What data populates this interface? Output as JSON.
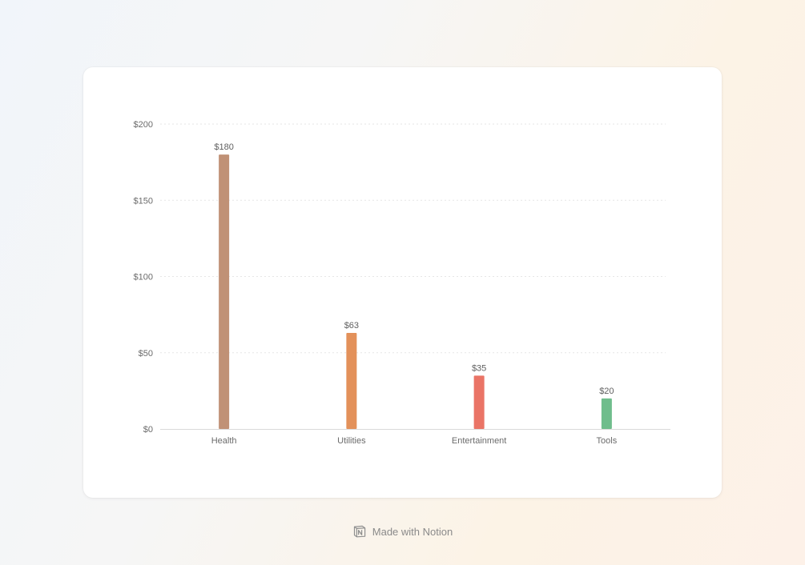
{
  "chart_data": {
    "type": "bar",
    "categories": [
      "Health",
      "Utilities",
      "Entertainment",
      "Tools"
    ],
    "values": [
      180,
      63,
      35,
      20
    ],
    "value_labels": [
      "$180",
      "$63",
      "$35",
      "$20"
    ],
    "colors": [
      "#c09176",
      "#e3915a",
      "#ea7466",
      "#6fbd8c"
    ],
    "yticks": [
      0,
      50,
      100,
      150,
      200
    ],
    "ytick_labels": [
      "$0",
      "$50",
      "$100",
      "$150",
      "$200"
    ],
    "ylim": [
      0,
      200
    ],
    "grid": true,
    "title": "",
    "xlabel": "",
    "ylabel": ""
  },
  "footer": {
    "text": "Made with Notion",
    "icon": "notion-logo-icon"
  }
}
